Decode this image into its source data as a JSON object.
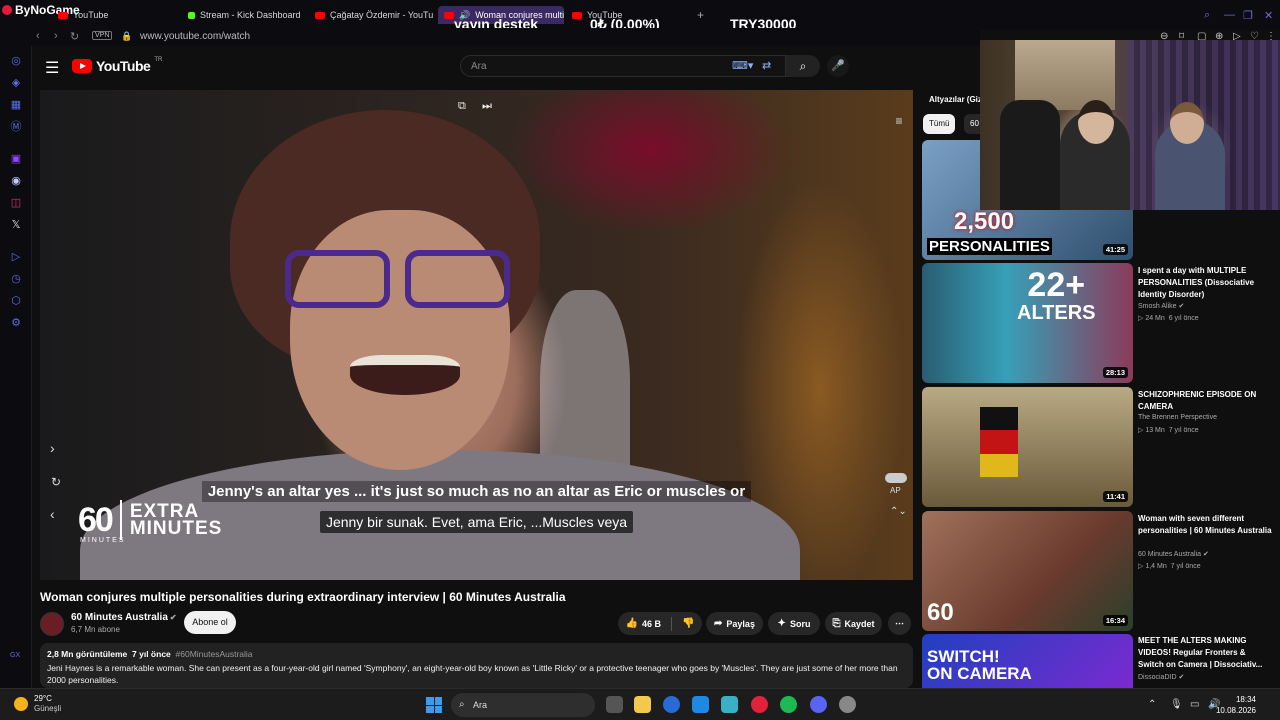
{
  "browser": {
    "brand": "ByNoGame",
    "tabs": [
      {
        "label": "YouTube"
      },
      {
        "label": "Stream - Kick Dashboard"
      },
      {
        "label": "Çağatay Özdemir - YouTub"
      },
      {
        "label": "Woman conjures multip"
      },
      {
        "label": "YouTube"
      }
    ],
    "url": "www.youtube.com/watch",
    "vpn": "VPN"
  },
  "stream_overlay": {
    "left_text": "yayın destek",
    "mid_text": "0₺ (0.00%)",
    "right_text": "TRY30000"
  },
  "youtube": {
    "wordmark": "YouTube",
    "country": "TR",
    "search_placeholder": "Ara"
  },
  "player": {
    "caption_original": "Jenny's an altar yes ... it's just so much as no an altar as Eric or muscles or",
    "caption_translated": "Jenny bir sunak. Evet, ama Eric, ...Muscles veya",
    "logo_number": "60",
    "logo_minutes": "MINUTES",
    "logo_extra_1": "EXTRA",
    "logo_extra_2": "MINUTES",
    "autoplay_label": "AP"
  },
  "video": {
    "title": "Woman conjures multiple personalities during extraordinary interview | 60 Minutes Australia",
    "channel": "60 Minutes Australia",
    "subscribers": "6,7 Mn abone",
    "subscribe_label": "Abone ol",
    "likes": "46 B",
    "share_label": "Paylaş",
    "ask_label": "Soru",
    "save_label": "Kaydet",
    "views": "2,8 Mn görüntüleme",
    "age": "7 yıl önce",
    "hashtag": "#60MinutesAustralia",
    "description": "Jeni Haynes is a remarkable woman. She can present as a four-year-old girl named 'Symphony', an eight-year-old boy known as 'Little Ricky' or a protective teenager who goes by 'Muscles'. They are just some of her more than 2000 personalities."
  },
  "recommendations": {
    "header": "Altyazılar (Giz",
    "chips": [
      "Tümü",
      "60"
    ],
    "items": [
      {
        "thumb_text_1": "2,500",
        "thumb_text_2": "PERSONALITIES",
        "duration": "41:25",
        "title": "",
        "channel": "",
        "views": "",
        "age": ""
      },
      {
        "thumb_text_1": "22+",
        "thumb_text_2": "ALTERS",
        "duration": "28:13",
        "title": "I spent a day with MULTIPLE PERSONALITIES (Dissociative Identity Disorder)",
        "channel": "Smosh Alike",
        "views": "24 Mn",
        "age": "6 yıl önce"
      },
      {
        "thumb_text_1": "",
        "thumb_text_2": "",
        "duration": "11:41",
        "title": "SCHIZOPHRENIC EPISODE ON CAMERA",
        "channel": "The Brennen Perspective",
        "views": "13 Mn",
        "age": "7 yıl önce"
      },
      {
        "thumb_text_1": "60",
        "thumb_text_2": "",
        "duration": "16:34",
        "title": "Woman with seven different personalities | 60 Minutes Australia",
        "channel": "60 Minutes Australia",
        "views": "1,4 Mn",
        "age": "7 yıl önce"
      },
      {
        "thumb_text_1": "SWITCH!",
        "thumb_text_2": "ON CAMERA",
        "duration": "",
        "title": "MEET THE ALTERS MAKING VIDEOS! Regular Fronters & Switch on Camera | Dissociativ...",
        "channel": "DissociaDID",
        "views": "",
        "age": ""
      }
    ]
  },
  "taskbar": {
    "temperature": "29°C",
    "condition": "Güneşli",
    "search_label": "Ara",
    "time": "18:34",
    "date": "10.08.2026"
  },
  "sidebar": {
    "gx_label": "GX"
  },
  "colors": {
    "youtube_red": "#ff0000",
    "gx_accent": "#5c6fe8",
    "active_tab": "#3a2a64"
  }
}
